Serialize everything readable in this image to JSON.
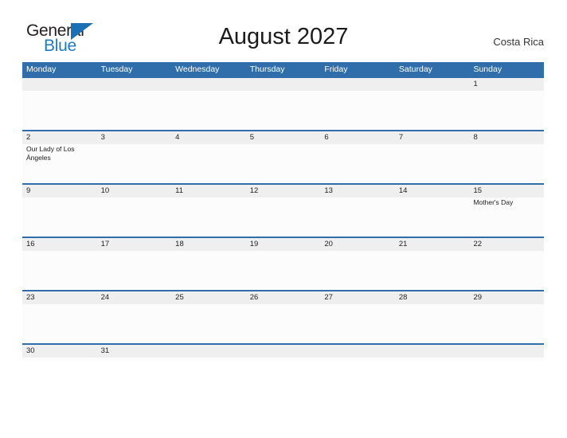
{
  "logo": {
    "word_one": "General",
    "word_two": "Blue",
    "triangle_icon": "triangle-icon",
    "color_dark": "#231f20",
    "color_blue": "#1a7bc9"
  },
  "header": {
    "title": "August 2027",
    "region": "Costa Rica"
  },
  "theme": {
    "header_blue": "#2f6eab",
    "number_band_gray": "#efefef",
    "cell_background": "#fcfcfc",
    "page_background": "#ffffff"
  },
  "calendar": {
    "day_names": [
      "Monday",
      "Tuesday",
      "Wednesday",
      "Thursday",
      "Friday",
      "Saturday",
      "Sunday"
    ],
    "weeks": [
      {
        "days": [
          {
            "num": "",
            "event": ""
          },
          {
            "num": "",
            "event": ""
          },
          {
            "num": "",
            "event": ""
          },
          {
            "num": "",
            "event": ""
          },
          {
            "num": "",
            "event": ""
          },
          {
            "num": "",
            "event": ""
          },
          {
            "num": "1",
            "event": ""
          }
        ]
      },
      {
        "days": [
          {
            "num": "2",
            "event": "Our Lady of Los Ángeles"
          },
          {
            "num": "3",
            "event": ""
          },
          {
            "num": "4",
            "event": ""
          },
          {
            "num": "5",
            "event": ""
          },
          {
            "num": "6",
            "event": ""
          },
          {
            "num": "7",
            "event": ""
          },
          {
            "num": "8",
            "event": ""
          }
        ]
      },
      {
        "days": [
          {
            "num": "9",
            "event": ""
          },
          {
            "num": "10",
            "event": ""
          },
          {
            "num": "11",
            "event": ""
          },
          {
            "num": "12",
            "event": ""
          },
          {
            "num": "13",
            "event": ""
          },
          {
            "num": "14",
            "event": ""
          },
          {
            "num": "15",
            "event": "Mother's Day"
          }
        ]
      },
      {
        "days": [
          {
            "num": "16",
            "event": ""
          },
          {
            "num": "17",
            "event": ""
          },
          {
            "num": "18",
            "event": ""
          },
          {
            "num": "19",
            "event": ""
          },
          {
            "num": "20",
            "event": ""
          },
          {
            "num": "21",
            "event": ""
          },
          {
            "num": "22",
            "event": ""
          }
        ]
      },
      {
        "days": [
          {
            "num": "23",
            "event": ""
          },
          {
            "num": "24",
            "event": ""
          },
          {
            "num": "25",
            "event": ""
          },
          {
            "num": "26",
            "event": ""
          },
          {
            "num": "27",
            "event": ""
          },
          {
            "num": "28",
            "event": ""
          },
          {
            "num": "29",
            "event": ""
          }
        ]
      },
      {
        "days": [
          {
            "num": "30",
            "event": ""
          },
          {
            "num": "31",
            "event": ""
          },
          {
            "num": "",
            "event": ""
          },
          {
            "num": "",
            "event": ""
          },
          {
            "num": "",
            "event": ""
          },
          {
            "num": "",
            "event": ""
          },
          {
            "num": "",
            "event": ""
          }
        ]
      }
    ]
  }
}
